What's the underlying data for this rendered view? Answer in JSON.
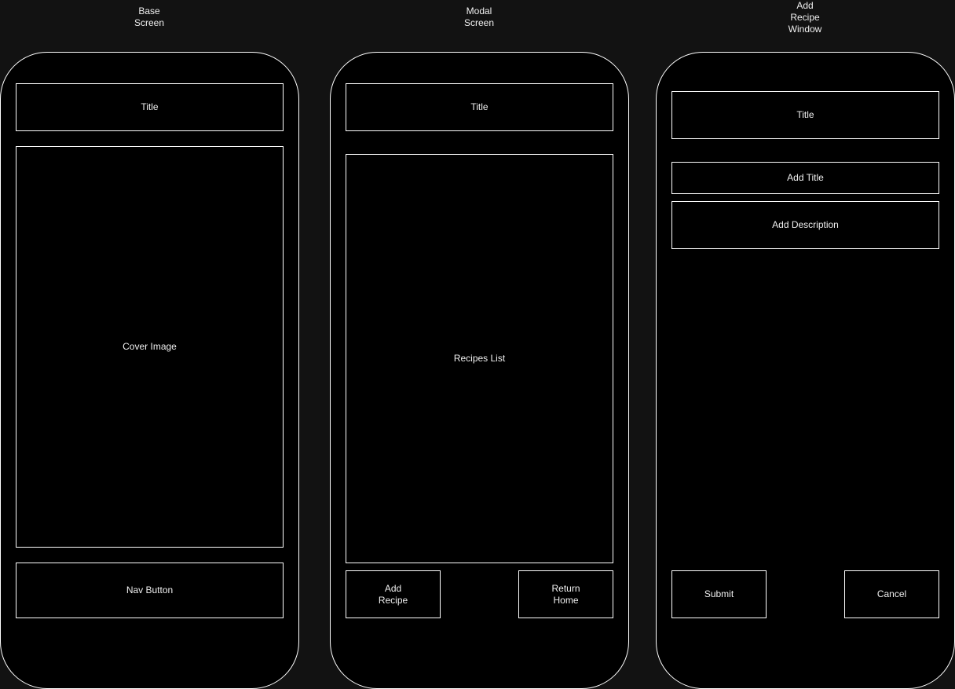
{
  "colors": {
    "canvas": "#121212",
    "screen": "#000000",
    "stroke": "#ffffff",
    "text": "#f0f0f0"
  },
  "base_screen": {
    "caption": "Base\nScreen",
    "title": "Title",
    "cover_image": "Cover Image",
    "nav_button": "Nav Button"
  },
  "modal_screen": {
    "caption": "Modal\nScreen",
    "title": "Title",
    "recipes_list": "Recipes List",
    "add_recipe_button": "Add\nRecipe",
    "return_home_button": "Return\nHome"
  },
  "add_recipe_window": {
    "caption": "Add\nRecipe\nWindow",
    "title": "Title",
    "add_title_field": "Add Title",
    "add_description_field": "Add Description",
    "submit_button": "Submit",
    "cancel_button": "Cancel"
  }
}
